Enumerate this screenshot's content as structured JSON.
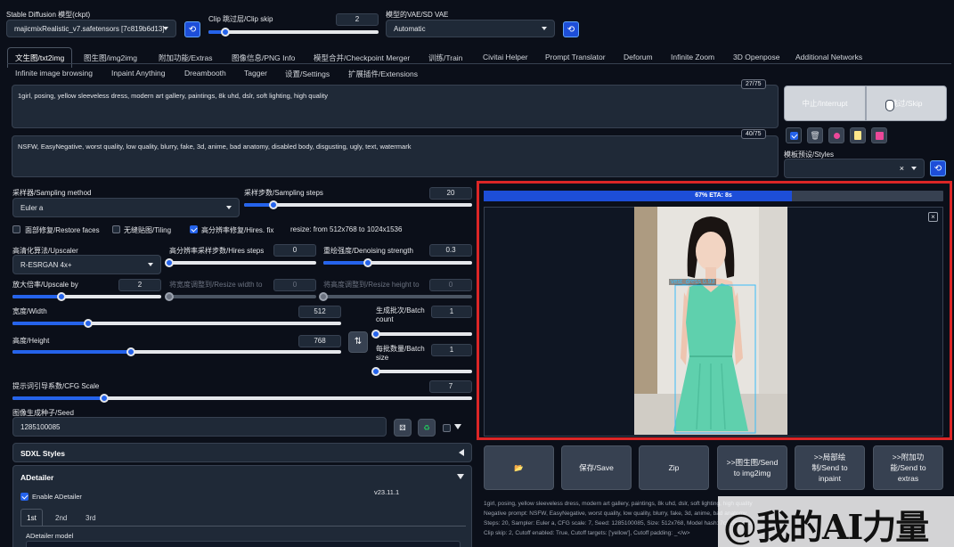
{
  "top": {
    "model_label": "Stable Diffusion 模型(ckpt)",
    "model_value": "majicmixRealistic_v7.safetensors [7c819b6d13]",
    "clip_label": "Clip 跳过层/Clip skip",
    "clip_value": "2",
    "clip_fraction": 0.1,
    "vae_label": "模型的VAE/SD VAE",
    "vae_value": "Automatic"
  },
  "tabs_row1": [
    "文生图/txt2img",
    "图生图/img2img",
    "附加功能/Extras",
    "图像信息/PNG Info",
    "模型合并/Checkpoint Merger",
    "训练/Train",
    "Civitai Helper",
    "Prompt Translator",
    "Deforum",
    "Infinite Zoom",
    "3D Openpose",
    "Additional Networks"
  ],
  "tabs_row2": [
    "Infinite image browsing",
    "Inpaint Anything",
    "Dreambooth",
    "Tagger",
    "设置/Settings",
    "扩展插件/Extensions"
  ],
  "prompt": {
    "text": "1girl, posing, yellow sleeveless dress, modern art gallery, paintings, 8k uhd, dslr, soft lighting, high quality",
    "counter": "27/75"
  },
  "negative": {
    "text": "NSFW, EasyNegative, worst quality, low quality, blurry, fake, 3d, anime, bad anatomy, disabled body, disgusting, ugly, text, watermark",
    "counter": "40/75"
  },
  "actions": {
    "interrupt": "中止/Interrupt",
    "skip": "跳过/Skip",
    "styles_label": "模板预设/Styles"
  },
  "sampling": {
    "method_label": "采样器/Sampling method",
    "method_value": "Euler a",
    "steps_label": "采样步数/Sampling steps",
    "steps_value": "20",
    "steps_fraction": 0.13
  },
  "checks": {
    "restore": "面部修复/Restore faces",
    "tiling": "无缝贴图/Tiling",
    "hires": "高分辨率修复/Hires. fix",
    "resize_note": "resize: from 512x768 to 1024x1536"
  },
  "hires": {
    "upscaler_label": "高清化算法/Upscaler",
    "upscaler_value": "R-ESRGAN 4x+",
    "hires_steps_label": "高分辨率采样步数/Hires steps",
    "hires_steps_value": "0",
    "denoise_label": "重绘强度/Denoising strength",
    "denoise_value": "0.3",
    "upscale_label": "放大倍率/Upscale by",
    "upscale_value": "2",
    "resize_w_label": "将宽度调整到/Resize width to",
    "resize_w_value": "0",
    "resize_h_label": "将高度调整到/Resize height to",
    "resize_h_value": "0"
  },
  "size": {
    "width_label": "宽度/Width",
    "width_value": "512",
    "width_fraction": 0.23,
    "height_label": "高度/Height",
    "height_value": "768",
    "height_fraction": 0.36,
    "batch_count_label": "生成批次/Batch count",
    "batch_count_value": "1",
    "batch_size_label": "每批数量/Batch size",
    "batch_size_value": "1"
  },
  "cfg": {
    "label": "提示词引导系数/CFG Scale",
    "value": "7",
    "fraction": 0.2
  },
  "seed": {
    "label": "图像生成种子/Seed",
    "value": "1285100085"
  },
  "sections": {
    "sdxl": "SDXL Styles",
    "adetailer": "ADetailer",
    "enable": "Enable ADetailer",
    "version": "v23.11.1",
    "tabs": [
      "1st",
      "2nd",
      "3rd"
    ],
    "model_label": "ADetailer model"
  },
  "output": {
    "progress_text": "67% ETA: 8s",
    "progress_fraction": 0.67,
    "detection_label": "vest_dress  0.93",
    "buttons": [
      "📂",
      "保存/Save",
      "Zip",
      ">>图生图/Send to img2img",
      ">>局部绘制/Send to inpaint",
      ">>附加功能/Send to extras"
    ],
    "info_lines": [
      "1girl, posing, yellow sleeveless dress, modern art gallery, paintings, 8k uhd, dslr, soft lighting, high quality",
      "Negative prompt: NSFW, EasyNegative, worst quality, low quality, blurry, fake, 3d, anime, bad anatomy,",
      "Steps: 20, Sampler: Euler a, CFG scale: 7, Seed: 1285100085, Size: 512x768, Model hash: 7c819b6d13",
      "Clip skip: 2, Cutoff enabled: True, Cutoff targets: ['yellow'], Cutoff padding: _</w>"
    ]
  },
  "watermark": "@我的AI力量",
  "colors": {
    "accent": "#2563eb",
    "highlight": "#dc2626",
    "background": "#0b0f19"
  }
}
